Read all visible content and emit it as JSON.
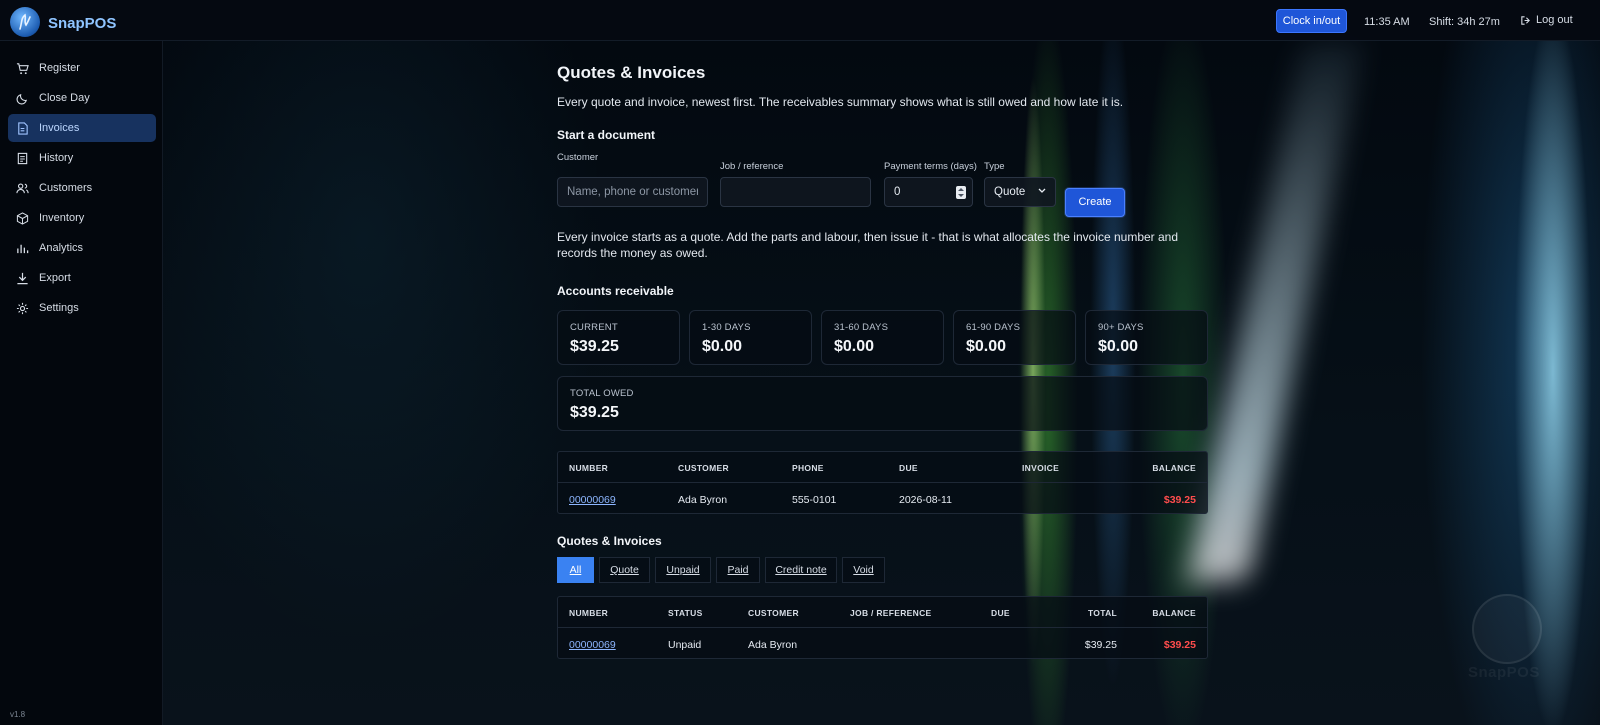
{
  "app": {
    "brand": "SnapPOS",
    "version": "v1.8"
  },
  "topbar": {
    "clock_label": "Clock in/out",
    "time": "11:35 AM",
    "shift": "Shift: 34h 27m",
    "logout_label": "Log out"
  },
  "sidebar": {
    "items": [
      {
        "label": "Register",
        "icon": "cart-icon"
      },
      {
        "label": "Close Day",
        "icon": "moon-icon"
      },
      {
        "label": "Invoices",
        "icon": "document-icon",
        "active": true
      },
      {
        "label": "History",
        "icon": "list-icon"
      },
      {
        "label": "Customers",
        "icon": "users-icon"
      },
      {
        "label": "Inventory",
        "icon": "box-icon"
      },
      {
        "label": "Analytics",
        "icon": "bar-chart-icon"
      },
      {
        "label": "Export",
        "icon": "download-icon"
      },
      {
        "label": "Settings",
        "icon": "gear-icon"
      }
    ]
  },
  "page": {
    "title": "Quotes & Invoices",
    "description": "Every quote and invoice, newest first. The receivables summary shows what is still owed and how late it is."
  },
  "start": {
    "heading": "Start a document",
    "customer_label": "Customer",
    "customer_placeholder": "Name, phone or customer",
    "job_label": "Job / reference",
    "job_value": "",
    "terms_label": "Payment terms (days)",
    "terms_value": "0",
    "type_label": "Type",
    "type_value": "Quote",
    "create_label": "Create",
    "note": "Every invoice starts as a quote. Add the parts and labour, then issue it - that is what allocates the invoice number and records the money as owed."
  },
  "receivable": {
    "heading": "Accounts receivable",
    "buckets": [
      {
        "label": "CURRENT",
        "value": "$39.25"
      },
      {
        "label": "1-30 DAYS",
        "value": "$0.00"
      },
      {
        "label": "31-60 DAYS",
        "value": "$0.00"
      },
      {
        "label": "61-90 DAYS",
        "value": "$0.00"
      },
      {
        "label": "90+ DAYS",
        "value": "$0.00"
      }
    ],
    "total_label": "TOTAL OWED",
    "total_value": "$39.25",
    "table": {
      "headers": [
        "NUMBER",
        "CUSTOMER",
        "PHONE",
        "DUE",
        "INVOICE",
        "BALANCE"
      ],
      "rows": [
        {
          "number": "00000069",
          "customer": "Ada Byron",
          "phone": "555-0101",
          "due": "2026-08-11",
          "invoice": "",
          "balance": "$39.25"
        }
      ]
    }
  },
  "list": {
    "heading": "Quotes & Invoices",
    "tabs": [
      "All",
      "Quote",
      "Unpaid",
      "Paid",
      "Credit note",
      "Void"
    ],
    "active_tab": "All",
    "table": {
      "headers": [
        "NUMBER",
        "STATUS",
        "CUSTOMER",
        "JOB / REFERENCE",
        "DUE",
        "TOTAL",
        "BALANCE"
      ],
      "rows": [
        {
          "number": "00000069",
          "status": "Unpaid",
          "customer": "Ada Byron",
          "job": "",
          "due": "",
          "total": "$39.25",
          "balance": "$39.25"
        }
      ]
    }
  },
  "colors": {
    "accent": "#1f56d8",
    "tab_active": "#3a82f2",
    "owed": "#ff4d4d",
    "link": "#8db6ff"
  }
}
